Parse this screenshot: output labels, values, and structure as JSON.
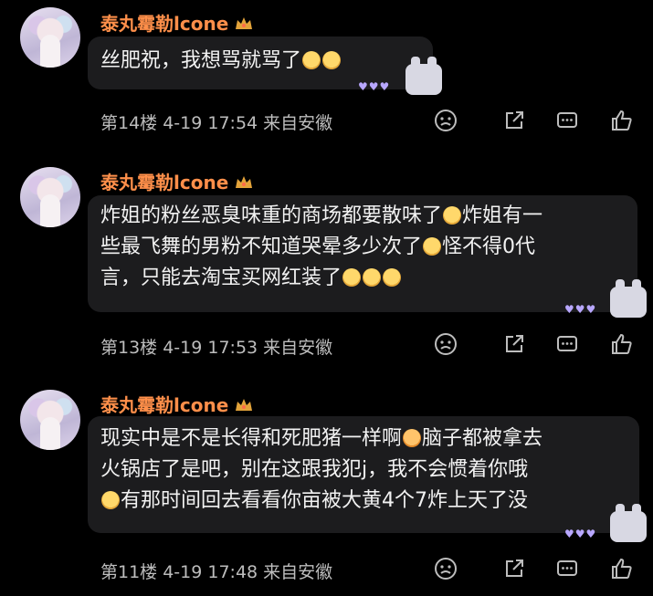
{
  "comments": [
    {
      "username": "泰丸霉勒lcone",
      "line1": "丝肥祝，我想骂就骂了",
      "line2": "",
      "line3": "",
      "floor_time_location": "第14楼 4-19 17:54 来自安徽"
    },
    {
      "username": "泰丸霉勒lcone",
      "line1": "炸姐的粉丝恶臭味重的商场都要散味了",
      "line1b": "炸姐有一",
      "line2": "些最飞舞的男粉不知道哭晕多少次了",
      "line2b": "怪不得0代",
      "line3": "言，只能去淘宝买网红装了",
      "floor_time_location": "第13楼 4-19 17:53 来自安徽"
    },
    {
      "username": "泰丸霉勒lcone",
      "line1": "现实中是不是长得和死肥猪一样啊",
      "line1b": "脑子都被拿去",
      "line2": "火锅店了是吧，别在这跟我犯j，我不会惯着你哦",
      "line3": "有那时间回去看看你亩被大黄4个7炸上天了没",
      "floor_time_location": "第11楼 4-19 17:48 来自安徽"
    }
  ],
  "icons": [
    "sad-face-icon",
    "share-icon",
    "comment-icon",
    "like-icon",
    "crown-icon"
  ],
  "colors": {
    "username": "#ff8f4a",
    "bubble": "#1c1c1e"
  }
}
